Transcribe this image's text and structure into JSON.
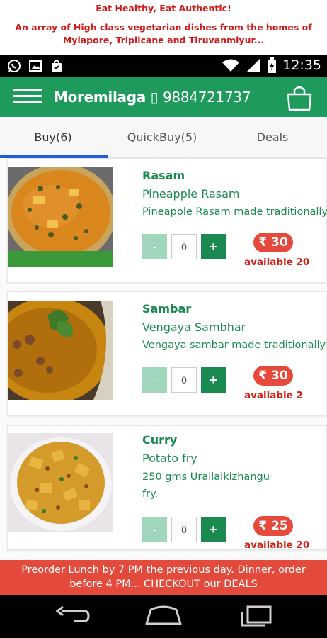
{
  "promo": {
    "line1": "Eat Healthy, Eat Authentic!",
    "line2": "An array of High class vegetarian dishes from the homes of Mylapore, Triplicane and Tiruvanmiyur..."
  },
  "status": {
    "time": "12:35"
  },
  "appbar": {
    "title": "Moremilaga",
    "phone_glyph": "▯",
    "phone": "9884721737"
  },
  "tabs": [
    {
      "label": "Buy(6)"
    },
    {
      "label": "QuickBuy(5)"
    },
    {
      "label": "Deals"
    }
  ],
  "items": [
    {
      "category": "Rasam",
      "name": "Pineapple Rasam",
      "description": "Pineapple Rasam made traditionally",
      "qty": "0",
      "price": "₹ 30",
      "available": "available 20"
    },
    {
      "category": "Sambar",
      "name": "Vengaya Sambhar",
      "description": "Vengaya sambar made traditionally",
      "qty": "0",
      "price": "₹ 30",
      "available": "available 2"
    },
    {
      "category": "Curry",
      "name": "Potato fry",
      "description": "250 gms Urailaikizhangu fry.",
      "qty": "0",
      "price": "₹ 25",
      "available": "available 20"
    }
  ],
  "qty_controls": {
    "minus": "-",
    "plus": "+"
  },
  "banner": "Preorder Lunch by 7 PM the previous day. Dinner, order before 4 PM... CHECKOUT our DEALS",
  "colors": {
    "primary": "#1e9b5c",
    "accent_red": "#e34a3b",
    "tab_indicator": "#1f5fd0"
  }
}
